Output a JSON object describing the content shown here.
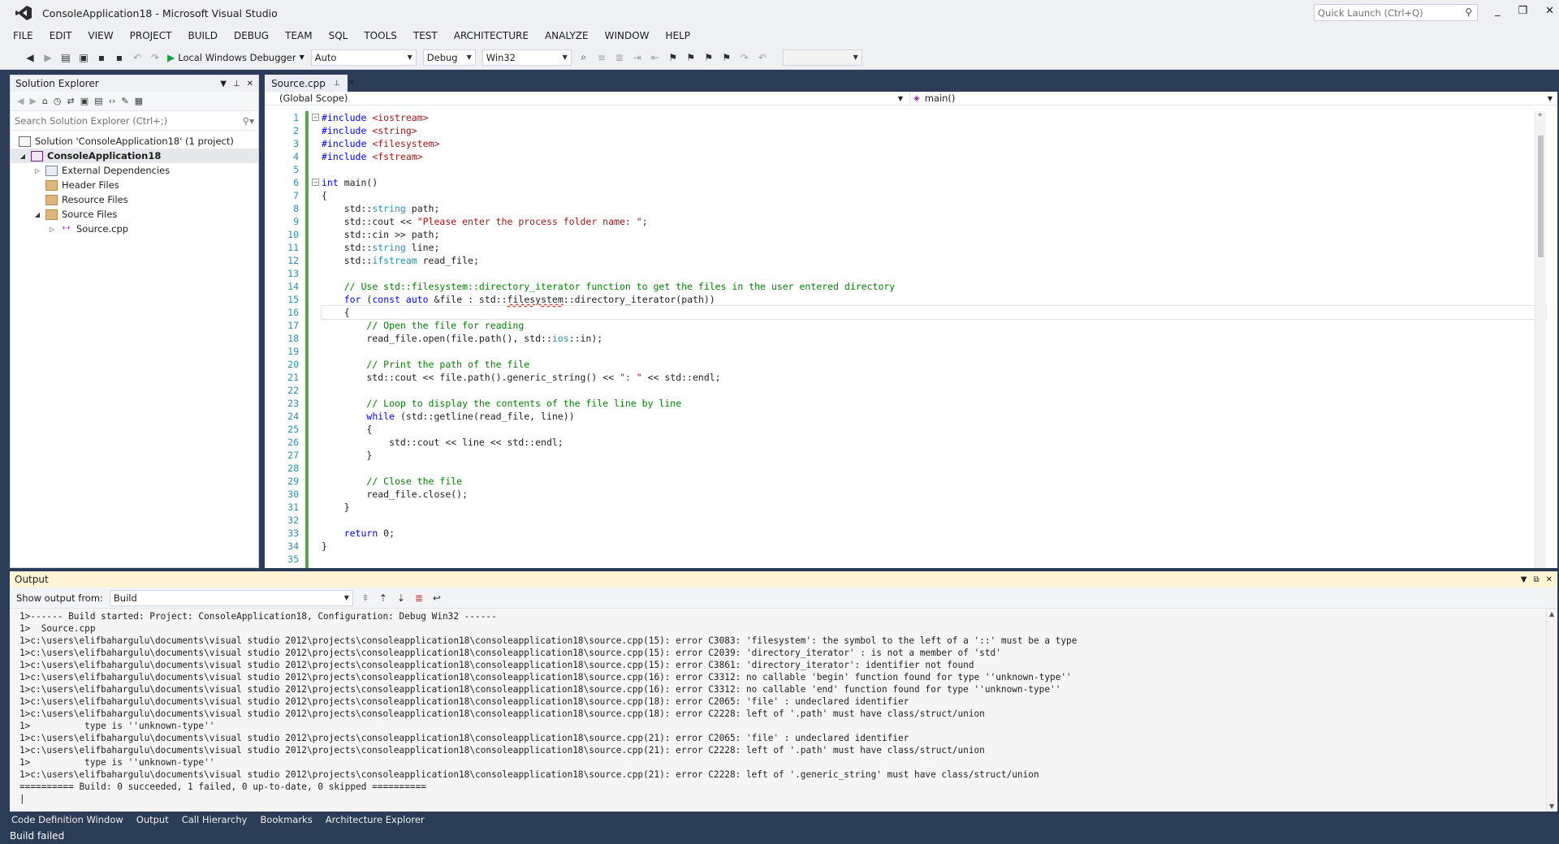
{
  "titlebar": {
    "title": "ConsoleApplication18 - Microsoft Visual Studio",
    "quick_launch_placeholder": "Quick Launch (Ctrl+Q)",
    "min": "_",
    "max": "❐",
    "close": "✕"
  },
  "menu": [
    "FILE",
    "EDIT",
    "VIEW",
    "PROJECT",
    "BUILD",
    "DEBUG",
    "TEAM",
    "SQL",
    "TOOLS",
    "TEST",
    "ARCHITECTURE",
    "ANALYZE",
    "WINDOW",
    "HELP"
  ],
  "toolbar": {
    "debugger_label": "Local Windows Debugger",
    "auto": "Auto",
    "config": "Debug",
    "platform": "Win32"
  },
  "solution_explorer": {
    "title": "Solution Explorer",
    "search_placeholder": "Search Solution Explorer (Ctrl+;)",
    "items": [
      {
        "label": "Solution 'ConsoleApplication18' (1 project)"
      },
      {
        "label": "ConsoleApplication18"
      },
      {
        "label": "External Dependencies"
      },
      {
        "label": "Header Files"
      },
      {
        "label": "Resource Files"
      },
      {
        "label": "Source Files"
      },
      {
        "label": "Source.cpp"
      }
    ]
  },
  "editor": {
    "tab_label": "Source.cpp",
    "scope_left": "(Global Scope)",
    "scope_right": "main()",
    "line_numbers": [
      "1",
      "2",
      "3",
      "4",
      "5",
      "6",
      "7",
      "8",
      "9",
      "10",
      "11",
      "12",
      "13",
      "14",
      "15",
      "16",
      "17",
      "18",
      "19",
      "20",
      "21",
      "22",
      "23",
      "24",
      "25",
      "26",
      "27",
      "28",
      "29",
      "30",
      "31",
      "32",
      "33",
      "34",
      "35"
    ]
  },
  "output": {
    "title": "Output",
    "show_from_label": "Show output from:",
    "source": "Build",
    "lines": [
      "1>------ Build started: Project: ConsoleApplication18, Configuration: Debug Win32 ------",
      "1>  Source.cpp",
      "1>c:\\users\\elifbahargulu\\documents\\visual studio 2012\\projects\\consoleapplication18\\consoleapplication18\\source.cpp(15): error C3083: 'filesystem': the symbol to the left of a '::' must be a type",
      "1>c:\\users\\elifbahargulu\\documents\\visual studio 2012\\projects\\consoleapplication18\\consoleapplication18\\source.cpp(15): error C2039: 'directory_iterator' : is not a member of 'std'",
      "1>c:\\users\\elifbahargulu\\documents\\visual studio 2012\\projects\\consoleapplication18\\consoleapplication18\\source.cpp(15): error C3861: 'directory_iterator': identifier not found",
      "1>c:\\users\\elifbahargulu\\documents\\visual studio 2012\\projects\\consoleapplication18\\consoleapplication18\\source.cpp(16): error C3312: no callable 'begin' function found for type ''unknown-type''",
      "1>c:\\users\\elifbahargulu\\documents\\visual studio 2012\\projects\\consoleapplication18\\consoleapplication18\\source.cpp(16): error C3312: no callable 'end' function found for type ''unknown-type''",
      "1>c:\\users\\elifbahargulu\\documents\\visual studio 2012\\projects\\consoleapplication18\\consoleapplication18\\source.cpp(18): error C2065: 'file' : undeclared identifier",
      "1>c:\\users\\elifbahargulu\\documents\\visual studio 2012\\projects\\consoleapplication18\\consoleapplication18\\source.cpp(18): error C2228: left of '.path' must have class/struct/union",
      "1>          type is ''unknown-type''",
      "1>c:\\users\\elifbahargulu\\documents\\visual studio 2012\\projects\\consoleapplication18\\consoleapplication18\\source.cpp(21): error C2065: 'file' : undeclared identifier",
      "1>c:\\users\\elifbahargulu\\documents\\visual studio 2012\\projects\\consoleapplication18\\consoleapplication18\\source.cpp(21): error C2228: left of '.path' must have class/struct/union",
      "1>          type is ''unknown-type''",
      "1>c:\\users\\elifbahargulu\\documents\\visual studio 2012\\projects\\consoleapplication18\\consoleapplication18\\source.cpp(21): error C2228: left of '.generic_string' must have class/struct/union",
      "========== Build: 0 succeeded, 1 failed, 0 up-to-date, 0 skipped =========="
    ]
  },
  "bottom_tabs": [
    "Code Definition Window",
    "Output",
    "Call Hierarchy",
    "Bookmarks",
    "Architecture Explorer"
  ],
  "status": "Build failed",
  "colors": {
    "frame": "#2b3c57",
    "keyword": "#0000ff",
    "comment": "#008000",
    "string": "#a31515",
    "type": "#2b91af",
    "change_bar": "#57a64a"
  }
}
